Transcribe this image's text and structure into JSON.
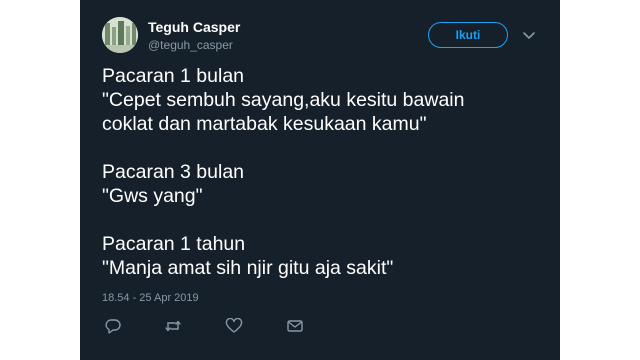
{
  "user": {
    "display_name": "Teguh Casper",
    "handle": "@teguh_casper"
  },
  "follow_label": "Ikuti",
  "tweet": {
    "paragraphs": [
      {
        "heading": "Pacaran 1 bulan",
        "lines": [
          "\"Cepet sembuh sayang,aku kesitu bawain",
          "coklat dan martabak kesukaan kamu\""
        ]
      },
      {
        "heading": "Pacaran 3 bulan",
        "lines": [
          "\"Gws yang\""
        ]
      },
      {
        "heading": "Pacaran 1 tahun",
        "lines": [
          "\"Manja amat sih njir gitu aja sakit\""
        ]
      }
    ],
    "timestamp": "18.54 - 25 Apr 2019"
  },
  "icons": {
    "avatar": "avatar",
    "caret": "chevron-down-icon",
    "reply": "reply-icon",
    "retweet": "retweet-icon",
    "like": "heart-icon",
    "message": "message-icon"
  },
  "colors": {
    "background": "#15202b",
    "accent": "#1da1f2",
    "muted": "#8899a6",
    "text": "#ffffff"
  }
}
